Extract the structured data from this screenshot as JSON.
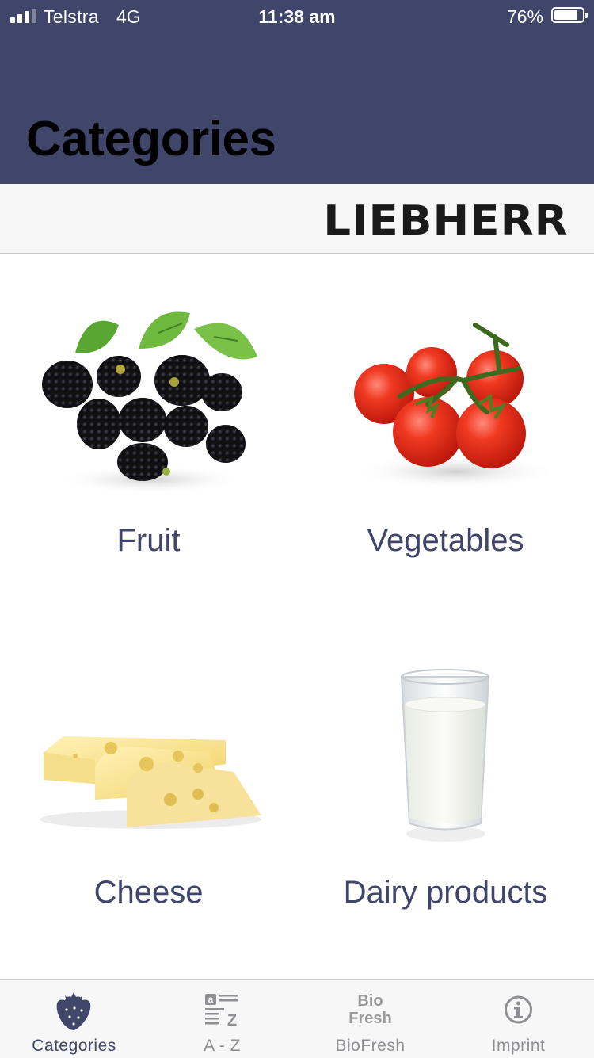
{
  "status_bar": {
    "carrier": "Telstra",
    "network": "4G",
    "time": "11:38 am",
    "battery_percent": "76%",
    "battery_level": 0.76,
    "signal_bars": 3
  },
  "header": {
    "title": "Categories",
    "background_color": "#3f4669"
  },
  "brand": {
    "logo_text": "LIEBHERR"
  },
  "categories": [
    {
      "label": "Fruit",
      "image": "blackberries"
    },
    {
      "label": "Vegetables",
      "image": "tomatoes"
    },
    {
      "label": "Cheese",
      "image": "cheese-slices"
    },
    {
      "label": "Dairy products",
      "image": "glass-of-milk"
    }
  ],
  "tab_bar": {
    "active": "Categories",
    "tabs": [
      {
        "label": "Categories",
        "icon": "strawberry-icon"
      },
      {
        "label": "A - Z",
        "icon": "a-z-icon"
      },
      {
        "label": "BioFresh",
        "icon": "biofresh-icon",
        "icon_text_1": "Bio",
        "icon_text_2": "Fresh"
      },
      {
        "label": "Imprint",
        "icon": "info-icon"
      }
    ]
  },
  "colors": {
    "accent": "#3f4669",
    "inactive_tab": "#8e8e93"
  }
}
